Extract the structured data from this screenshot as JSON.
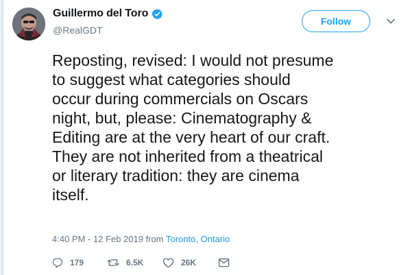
{
  "author": {
    "display_name": "Guillermo del Toro",
    "handle": "@RealGDT",
    "verified_icon": "verified-badge-icon",
    "avatar": "avatar-photo"
  },
  "header": {
    "follow_label": "Follow",
    "menu_icon": "chevron-down-icon"
  },
  "tweet": {
    "lines": [
      "Reposting, revised: I would not presume",
      "to suggest what categories should",
      "occur during commercials on Oscars",
      "night,  but, please: Cinematography &",
      "Editing are at the very heart of our craft.",
      "They are not inherited from a theatrical",
      "or literary tradition: they are cinema",
      "itself."
    ]
  },
  "meta": {
    "timestamp": "4:40 PM - 12 Feb 2019",
    "from_label": "from",
    "location": "Toronto, Ontario"
  },
  "actions": {
    "replies": "179",
    "retweets": "6.5K",
    "likes": "26K"
  },
  "colors": {
    "accent": "#1da1f2",
    "link": "#1b95e0",
    "secondary_text": "#657786",
    "primary_text": "#14171a",
    "rule": "#e1e8ed"
  }
}
